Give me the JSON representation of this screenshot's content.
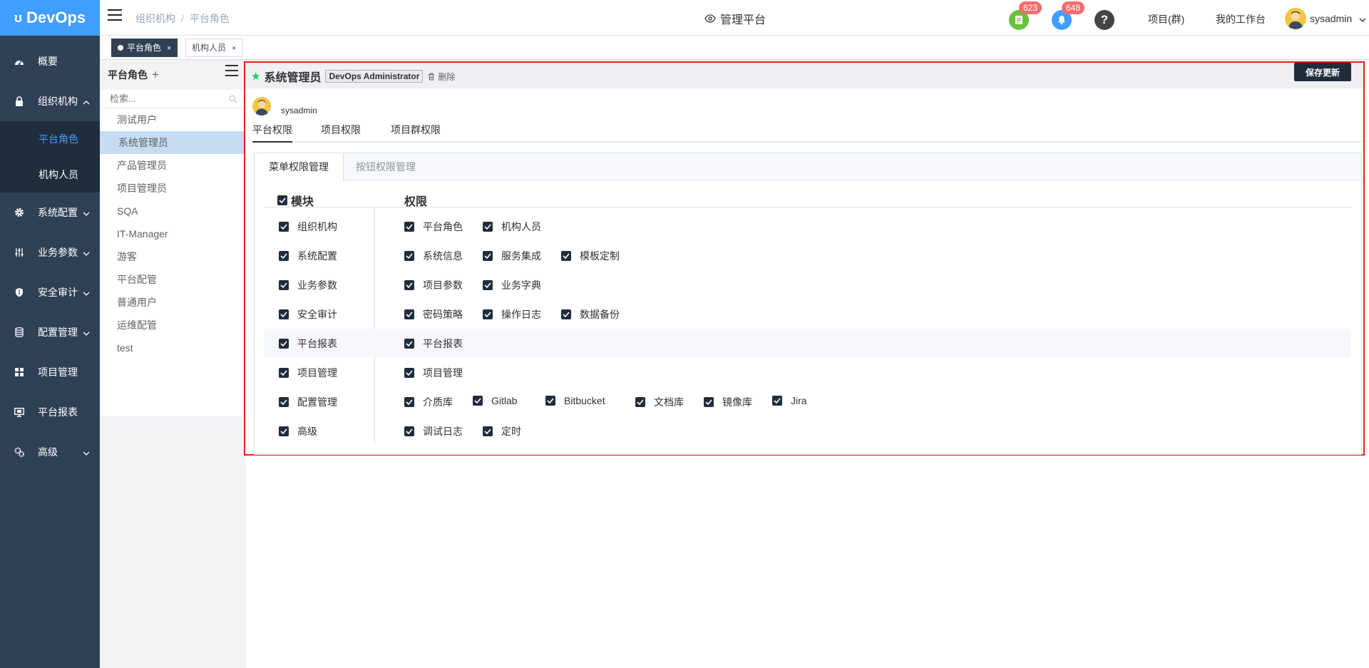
{
  "app": {
    "logo": "DevOps"
  },
  "sidebar": {
    "items": [
      {
        "label": "概要",
        "icon": "dashboard-icon"
      },
      {
        "label": "组织机构",
        "icon": "lock-icon",
        "expanded": true,
        "children": [
          {
            "label": "平台角色",
            "active": true
          },
          {
            "label": "机构人员"
          }
        ]
      },
      {
        "label": "系统配置",
        "icon": "gear-icon"
      },
      {
        "label": "业务参数",
        "icon": "sliders-icon"
      },
      {
        "label": "安全审计",
        "icon": "shield-icon"
      },
      {
        "label": "配置管理",
        "icon": "database-icon"
      },
      {
        "label": "项目管理",
        "icon": "grid-icon"
      },
      {
        "label": "平台报表",
        "icon": "monitor-icon"
      },
      {
        "label": "高级",
        "icon": "cogs-icon"
      }
    ]
  },
  "header": {
    "breadcrumb": [
      "组织机构",
      "平台角色"
    ],
    "title": "管理平台",
    "todo_badge": "623",
    "notify_badge": "648",
    "links": [
      "项目(群)",
      "我的工作台"
    ],
    "user": "sysadmin"
  },
  "tags": [
    {
      "label": "平台角色",
      "active": true
    },
    {
      "label": "机构人员",
      "active": false
    }
  ],
  "roles": {
    "title": "平台角色",
    "search_placeholder": "检索...",
    "items": [
      "测试用户",
      "系统管理员",
      "产品管理员",
      "项目管理员",
      "SQA",
      "IT-Manager",
      "游客",
      "平台配管",
      "普通用户",
      "运维配管",
      "test"
    ],
    "selected": "系统管理员"
  },
  "detail": {
    "name": "系统管理员",
    "code": "DevOps Administrator",
    "delete_label": "删除",
    "save_label": "保存更新",
    "user": "sysadmin",
    "tabs": [
      "平台权限",
      "项目权限",
      "项目群权限"
    ],
    "subtabs": [
      "菜单权限管理",
      "按钮权限管理"
    ],
    "col_module": "模块",
    "col_perm": "权限",
    "rows": [
      {
        "module": "组织机构",
        "perms": [
          "平台角色",
          "机构人员"
        ]
      },
      {
        "module": "系统配置",
        "perms": [
          "系统信息",
          "服务集成",
          "模板定制"
        ]
      },
      {
        "module": "业务参数",
        "perms": [
          "项目参数",
          "业务字典"
        ]
      },
      {
        "module": "安全审计",
        "perms": [
          "密码策略",
          "操作日志",
          "数据备份"
        ]
      },
      {
        "module": "平台报表",
        "perms": [
          "平台报表"
        ]
      },
      {
        "module": "项目管理",
        "perms": [
          "项目管理"
        ]
      },
      {
        "module": "配置管理",
        "perms": [
          "介质库",
          "Gitlab",
          "Bitbucket",
          "文档库",
          "镜像库",
          "Jira"
        ]
      },
      {
        "module": "高级",
        "perms": [
          "调试日志",
          "定时"
        ]
      }
    ]
  },
  "colors": {
    "sidebar_bg": "#304156",
    "accent": "#409eff",
    "highlight_border": "#e5211a",
    "checkbox": "#1f2d3d"
  }
}
